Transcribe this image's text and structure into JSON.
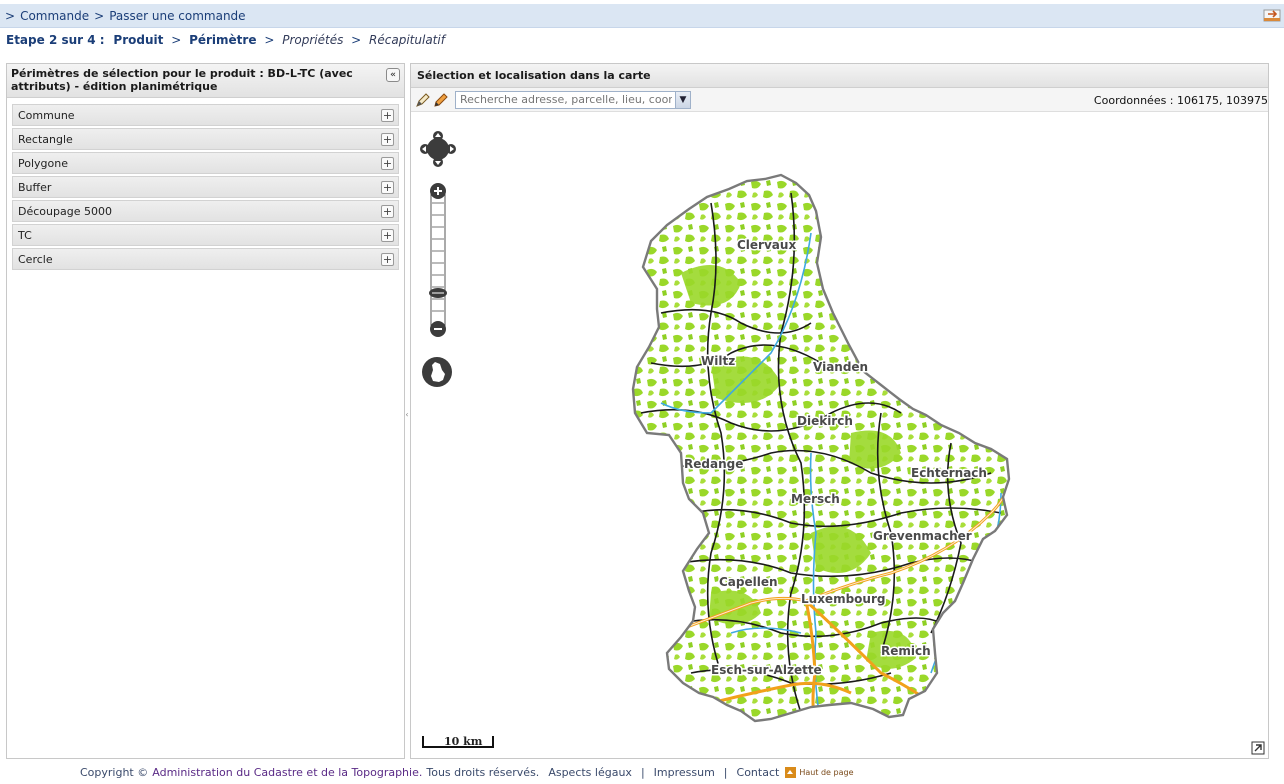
{
  "breadcrumb": {
    "items": [
      "Commande",
      "Passer une commande"
    ],
    "separator": ">"
  },
  "steps": {
    "prefix": "Etape 2 sur 4 :",
    "items": [
      {
        "label": "Produit",
        "state": "done"
      },
      {
        "label": "Périmètre",
        "state": "current"
      },
      {
        "label": "Propriétés",
        "state": "todo"
      },
      {
        "label": "Récapitulatif",
        "state": "todo"
      }
    ],
    "arrow": ">"
  },
  "left_panel": {
    "title": "Périmètres de sélection pour le produit : BD-L-TC (avec attributs) - édition planimétrique",
    "collapse_glyph": "«",
    "items": [
      {
        "label": "Commune"
      },
      {
        "label": "Rectangle"
      },
      {
        "label": "Polygone"
      },
      {
        "label": "Buffer"
      },
      {
        "label": "Découpage 5000"
      },
      {
        "label": "TC"
      },
      {
        "label": "Cercle"
      }
    ],
    "expand_glyph": "+"
  },
  "map_panel": {
    "title": "Sélection et localisation dans la carte",
    "search_placeholder": "Recherche adresse, parcelle, lieu, coordonnÃ©",
    "coords_label": "Coordonnées : 106175, 103975",
    "scale_label": "10 km",
    "towns": [
      "Clervaux",
      "Wiltz",
      "Vianden",
      "Diekirch",
      "Redange",
      "Echternach",
      "Mersch",
      "Grevenmacher",
      "Capellen",
      "Luxembourg",
      "Remich",
      "Esch-sur-Alzette"
    ],
    "icons": [
      "pan-icon",
      "zoom-in-icon",
      "zoom-out-icon",
      "zoom-slider-icon",
      "extent-icon",
      "expand-icon"
    ]
  },
  "footer": {
    "copyright_prefix": "Copyright ©",
    "org": "Administration du Cadastre et de la Topographie.",
    "rights": "Tous droits réservés.",
    "links": [
      "Aspects légaux",
      "Impressum",
      "Contact"
    ],
    "top_link": "Haut de page"
  },
  "colors": {
    "breadcrumb_bg": "#dbe6f3",
    "link_blue": "#1b3e78",
    "forest_green": "#9ad829",
    "road_orange": "#f2a11a",
    "water_blue": "#3fa9e0"
  }
}
